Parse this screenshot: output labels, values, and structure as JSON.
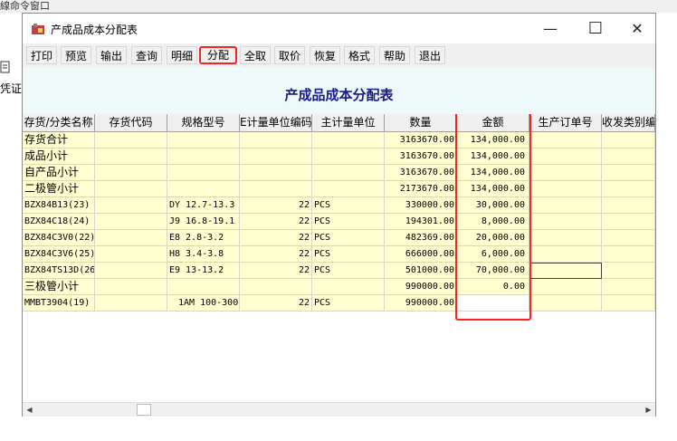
{
  "background": {
    "top_text": "線命令窗口",
    "side_text": "凭证"
  },
  "window": {
    "title": "产成品成本分配表",
    "minimize": "—",
    "maximize": "☐",
    "close": "✕"
  },
  "toolbar": {
    "buttons": [
      "打印",
      "预览",
      "输出",
      "查询",
      "明细",
      "分配",
      "全取",
      "取价",
      "恢复",
      "格式",
      "帮助",
      "退出"
    ],
    "highlighted": "分配"
  },
  "report": {
    "title": "产成品成本分配表"
  },
  "table": {
    "headers": [
      "存货/分类名称",
      "存货代码",
      "规格型号",
      "E计量单位编码",
      "主计量单位",
      "数量",
      "金额",
      "生产订单号",
      "收发类别编"
    ],
    "rows": [
      [
        "存货合计",
        "",
        "",
        "",
        "",
        "3163670.00",
        "134,000.00",
        "",
        ""
      ],
      [
        "成品小计",
        "",
        "",
        "",
        "",
        "3163670.00",
        "134,000.00",
        "",
        ""
      ],
      [
        "自产品小计",
        "",
        "",
        "",
        "",
        "3163670.00",
        "134,000.00",
        "",
        ""
      ],
      [
        "二极管小计",
        "",
        "",
        "",
        "",
        "2173670.00",
        "134,000.00",
        "",
        ""
      ],
      [
        "BZX84B13(23)",
        "",
        "DY 12.7-13.3",
        "22",
        "PCS",
        "330000.00",
        "30,000.00",
        "",
        ""
      ],
      [
        "BZX84C18(24)",
        "",
        "J9 16.8-19.1",
        "22",
        "PCS",
        "194301.00",
        "8,000.00",
        "",
        ""
      ],
      [
        "BZX84C3V0(22)",
        "",
        "E8 2.8-3.2",
        "22",
        "PCS",
        "482369.00",
        "20,000.00",
        "",
        ""
      ],
      [
        "BZX84C3V6(25)",
        "",
        "H8 3.4-3.8",
        "22",
        "PCS",
        "666000.00",
        "6,000.00",
        "",
        ""
      ],
      [
        "BZX84TS13D(26)",
        "",
        "E9 13-13.2",
        "22",
        "PCS",
        "501000.00",
        "70,000.00",
        "",
        ""
      ],
      [
        "三极管小计",
        "",
        "",
        "",
        "",
        "990000.00",
        "0.00",
        "",
        ""
      ],
      [
        "MMBT3904(19)",
        "",
        "1AM 100-300",
        "22",
        "PCS",
        "990000.00",
        "",
        "",
        ""
      ]
    ]
  },
  "colors": {
    "highlight": "#ff2020",
    "row_fill": "#ffffd0",
    "title_color": "#1a1a8c",
    "report_bg": "#eefafa"
  },
  "icons": [
    "app-icon",
    "minimize-icon",
    "maximize-icon",
    "close-icon",
    "scroll-left-icon",
    "scroll-right-icon"
  ]
}
